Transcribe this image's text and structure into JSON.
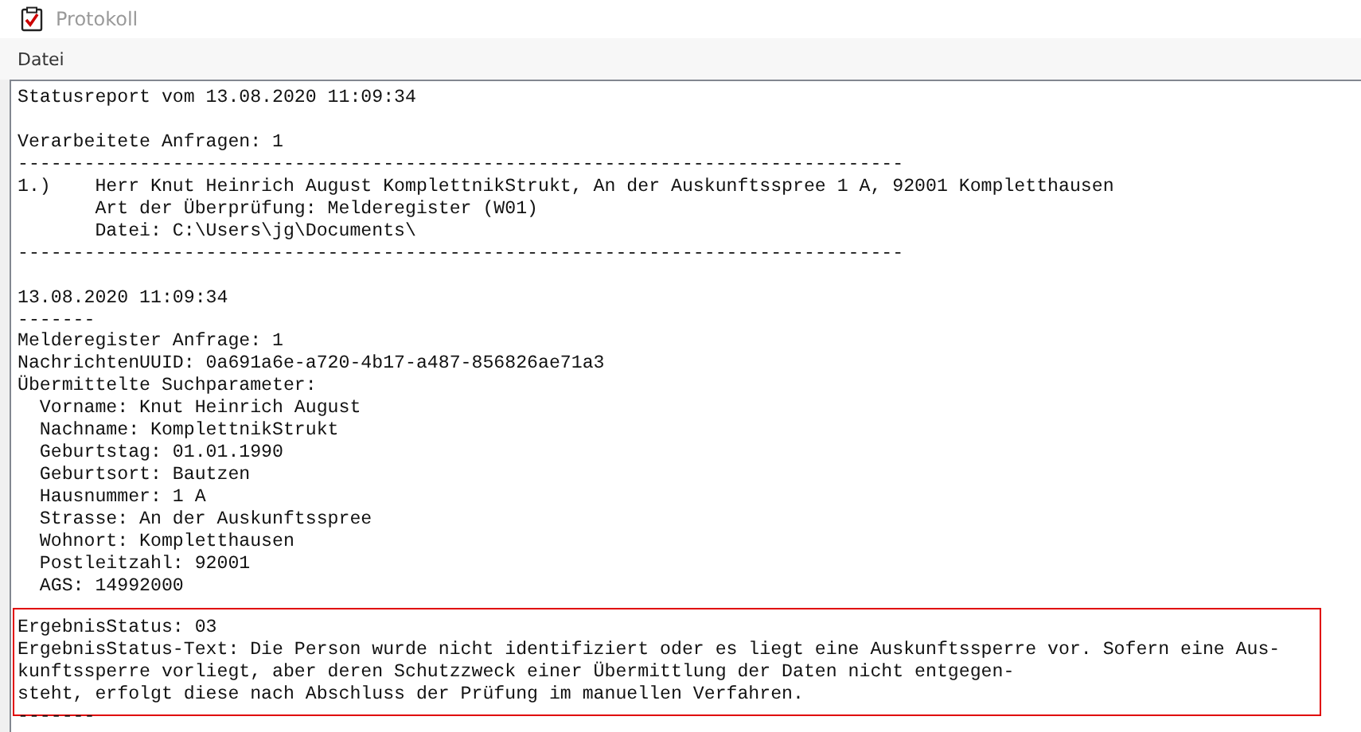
{
  "window": {
    "title": "Protokoll"
  },
  "menu": [
    {
      "label": "Datei"
    }
  ],
  "report": {
    "blocks": [
      {
        "highlighted": false,
        "lines": [
          "Statusreport vom 13.08.2020 11:09:34"
        ]
      },
      {
        "highlighted": false,
        "lines": [
          "Verarbeitete Anfragen: 1",
          "--------------------------------------------------------------------------------",
          "1.)    Herr Knut Heinrich August KomplettnikStrukt, An der Auskunftsspree 1 A, 92001 Kompletthausen",
          "       Art der Überprüfung: Melderegister (W01)",
          "       Datei: C:\\Users\\jg\\Documents\\",
          "--------------------------------------------------------------------------------"
        ]
      },
      {
        "highlighted": false,
        "lines": [
          "13.08.2020 11:09:34",
          "-------",
          "Melderegister Anfrage: 1",
          "NachrichtenUUID: 0a691a6e-a720-4b17-a487-856826ae71a3",
          "Übermittelte Suchparameter:",
          "  Vorname: Knut Heinrich August",
          "  Nachname: KomplettnikStrukt",
          "  Geburtstag: 01.01.1990",
          "  Geburtsort: Bautzen",
          "  Hausnummer: 1 A",
          "  Strasse: An der Auskunftsspree",
          "  Wohnort: Kompletthausen",
          "  Postleitzahl: 92001",
          "  AGS: 14992000"
        ]
      },
      {
        "highlighted": true,
        "lines": [
          "ErgebnisStatus: 03",
          "ErgebnisStatus-Text: Die Person wurde nicht identifiziert oder es liegt eine Auskunftssperre vor. Sofern eine Aus-",
          "kunftssperre vorliegt, aber deren Schutzzweck einer Übermittlung der Daten nicht entgegen-",
          "steht, erfolgt diese nach Abschluss der Prüfung im manuellen Verfahren."
        ]
      },
      {
        "highlighted": false,
        "lines": [
          "-------"
        ]
      }
    ]
  }
}
